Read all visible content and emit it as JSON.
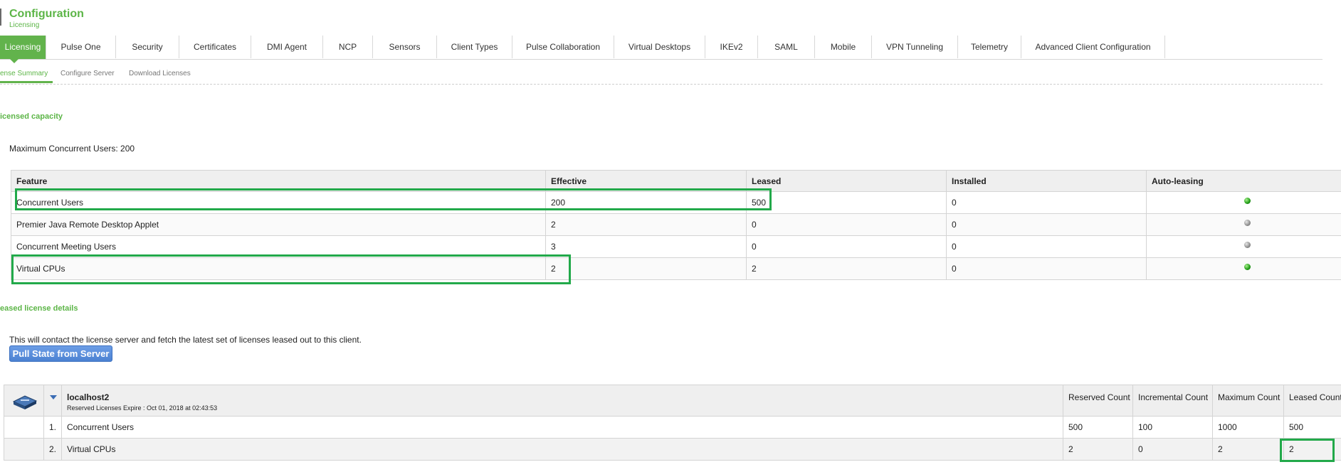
{
  "header": {
    "title": "Configuration",
    "subtitle": "Licensing"
  },
  "tabs": [
    {
      "label": "Licensing",
      "active": true
    },
    {
      "label": "Pulse One"
    },
    {
      "label": "Security"
    },
    {
      "label": "Certificates"
    },
    {
      "label": "DMI Agent"
    },
    {
      "label": "NCP"
    },
    {
      "label": "Sensors"
    },
    {
      "label": "Client Types"
    },
    {
      "label": "Pulse Collaboration"
    },
    {
      "label": "Virtual Desktops"
    },
    {
      "label": "IKEv2"
    },
    {
      "label": "SAML"
    },
    {
      "label": "Mobile"
    },
    {
      "label": "VPN Tunneling"
    },
    {
      "label": "Telemetry"
    },
    {
      "label": "Advanced Client Configuration"
    }
  ],
  "subtabs": [
    {
      "label": "ense Summary",
      "active": true
    },
    {
      "label": "Configure Server"
    },
    {
      "label": "Download Licenses"
    }
  ],
  "capacity": {
    "section_title": "icensed capacity",
    "max_users_text": "Maximum Concurrent Users: 200",
    "columns": [
      "Feature",
      "Effective",
      "Leased",
      "Installed",
      "Auto-leasing"
    ],
    "rows": [
      {
        "feature": "Concurrent Users",
        "effective": "200",
        "leased": "500",
        "installed": "0",
        "status": "green"
      },
      {
        "feature": "Premier Java Remote Desktop Applet",
        "effective": "2",
        "leased": "0",
        "installed": "0",
        "status": "grey"
      },
      {
        "feature": "Concurrent Meeting Users",
        "effective": "3",
        "leased": "0",
        "installed": "0",
        "status": "grey"
      },
      {
        "feature": "Virtual CPUs",
        "effective": "2",
        "leased": "2",
        "installed": "0",
        "status": "green"
      }
    ]
  },
  "leased": {
    "section_title": "eased license details",
    "description": "This will contact the license server and fetch the latest set of licenses leased out to this client.",
    "pull_button": "Pull State from Server",
    "server_name": "localhost2",
    "server_expiry": "Reserved Licenses Expire : Oct 01, 2018 at 02:43:53",
    "columns": [
      "Reserved Count",
      "Incremental Count",
      "Maximum Count",
      "Leased Count"
    ],
    "rows": [
      {
        "index": "1.",
        "feature": "Concurrent Users",
        "reserved": "500",
        "incremental": "100",
        "maximum": "1000",
        "leased": "500"
      },
      {
        "index": "2.",
        "feature": "Virtual CPUs",
        "reserved": "2",
        "incremental": "0",
        "maximum": "2",
        "leased": "2"
      }
    ]
  },
  "colors": {
    "accent": "#5cb547",
    "highlight": "#22a94a",
    "button": "#4c82d2"
  }
}
